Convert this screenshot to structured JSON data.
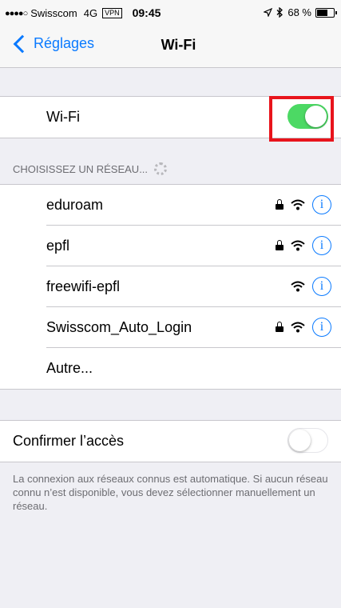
{
  "status_bar": {
    "signal_dots": "●●●●○",
    "carrier": "Swisscom",
    "network": "4G",
    "vpn": "VPN",
    "time": "09:45",
    "location_icon": "location-arrow-icon",
    "bluetooth_icon": "bluetooth-icon",
    "battery_percent": "68 %",
    "battery_level": 0.68
  },
  "nav": {
    "back_label": "Réglages",
    "title": "Wi-Fi"
  },
  "wifi": {
    "label": "Wi-Fi",
    "enabled": true,
    "toggle_color": "#4cd964"
  },
  "networks_header": "CHOISISSEZ UN RÉSEAU...",
  "networks": [
    {
      "name": "eduroam",
      "secured": true
    },
    {
      "name": "epfl",
      "secured": true
    },
    {
      "name": "freewifi-epfl",
      "secured": false
    },
    {
      "name": "Swisscom_Auto_Login",
      "secured": true
    }
  ],
  "other_label": "Autre...",
  "confirm": {
    "label": "Confirmer l’accès",
    "enabled": false
  },
  "footer_text": "La connexion aux réseaux connus est automatique. Si aucun réseau connu n’est disponible, vous devez sélectionner manuellement un réseau.",
  "colors": {
    "accent": "#0a7aff",
    "highlight_border": "#e8141c",
    "background": "#efeff4"
  }
}
